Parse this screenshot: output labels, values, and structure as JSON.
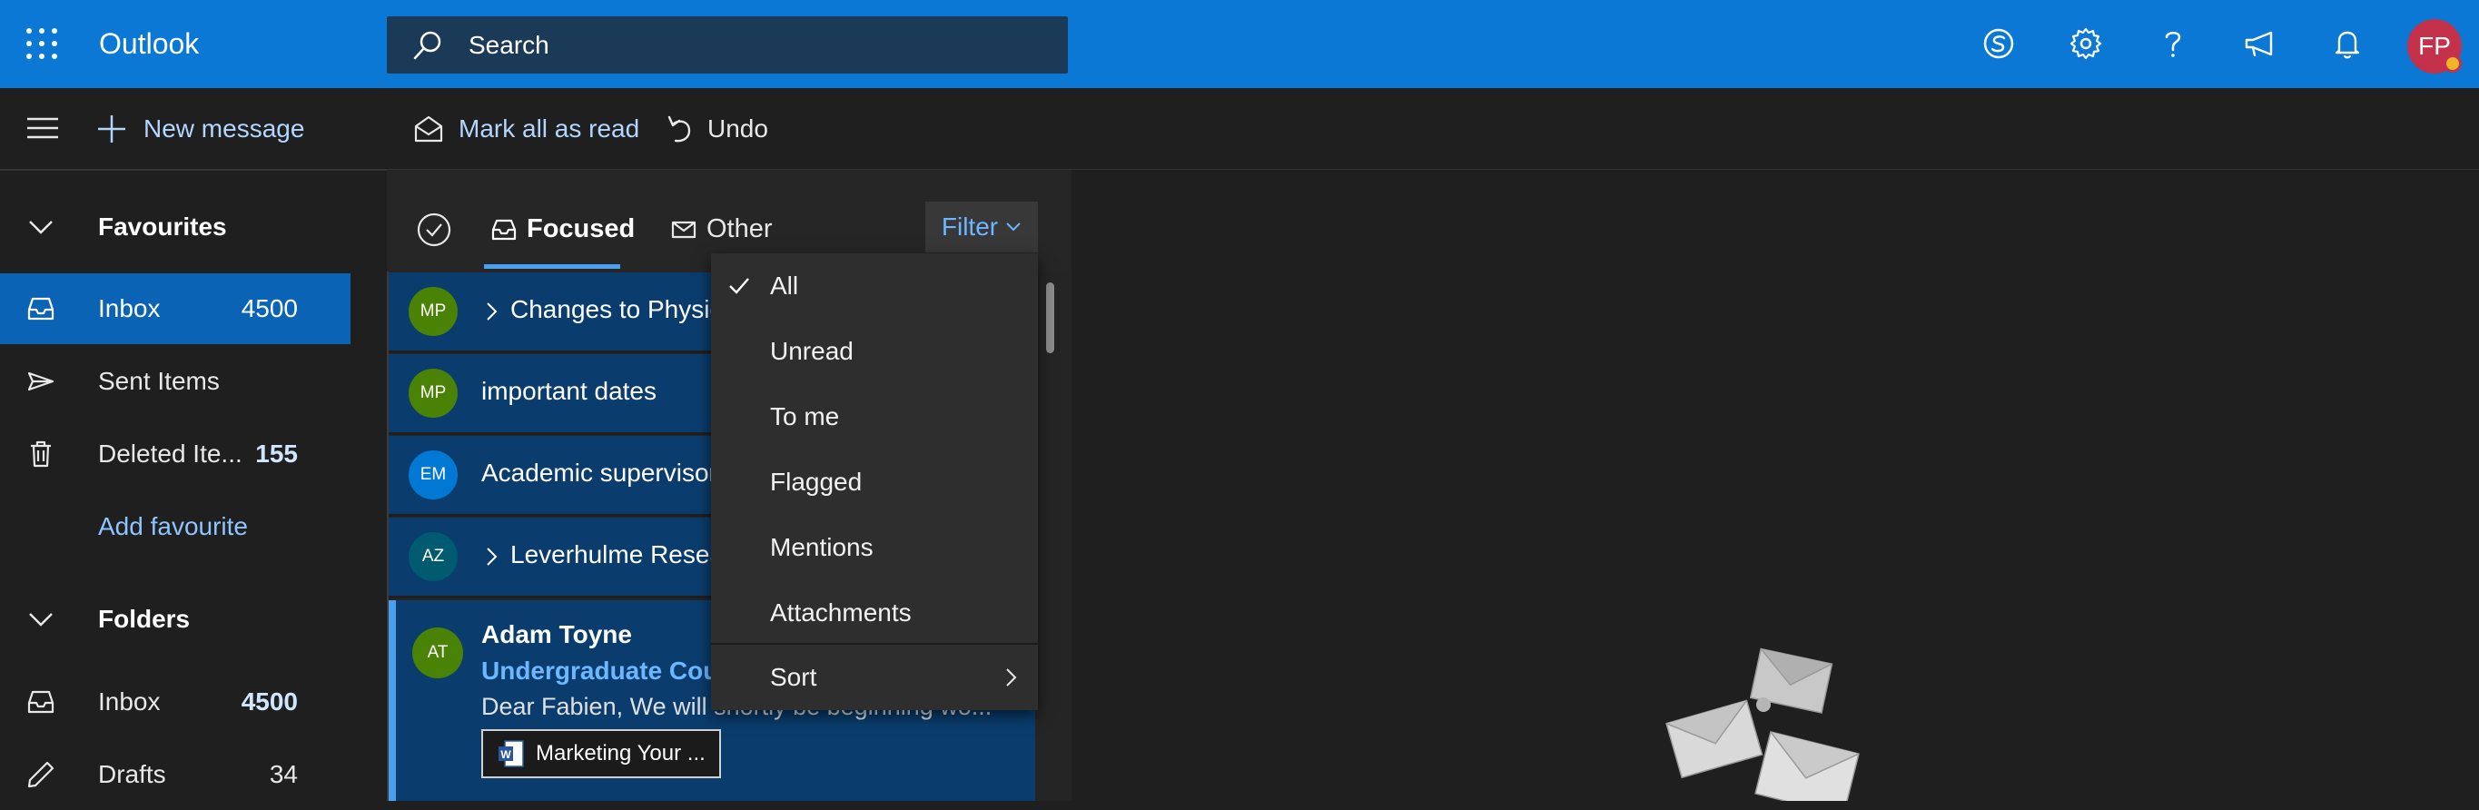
{
  "app": {
    "name": "Outlook"
  },
  "search": {
    "placeholder": "Search"
  },
  "user": {
    "initials": "FP"
  },
  "header_icons": [
    "skype-icon",
    "gear-icon",
    "help-icon",
    "feedback-icon",
    "bell-icon"
  ],
  "command_bar": {
    "new_message": "New message",
    "mark_all_read": "Mark all as read",
    "undo": "Undo"
  },
  "nav": {
    "favourites_header": "Favourites",
    "favourites": [
      {
        "label": "Inbox",
        "count": "4500"
      },
      {
        "label": "Sent Items",
        "count": ""
      },
      {
        "label": "Deleted Ite...",
        "count": "155"
      },
      {
        "label": "Add favourite",
        "count": ""
      }
    ],
    "folders_header": "Folders",
    "folders": [
      {
        "label": "Inbox",
        "count": "4500"
      },
      {
        "label": "Drafts",
        "count": "34"
      }
    ]
  },
  "list": {
    "tabs": {
      "focused": "Focused",
      "other": "Other"
    },
    "filter_label": "Filter",
    "messages": [
      {
        "initials": "MP",
        "subject": "Changes to Physic",
        "avatar_color": "#498205",
        "thread": true
      },
      {
        "initials": "MP",
        "subject": "important dates",
        "avatar_color": "#498205",
        "thread": false
      },
      {
        "initials": "EM",
        "subject": "Academic supervisor",
        "avatar_color": "#0078d4",
        "thread": false
      },
      {
        "initials": "AZ",
        "subject": "Leverhulme Resea",
        "avatar_color": "#005b70",
        "thread": true
      }
    ],
    "open_message": {
      "initials": "AT",
      "sender": "Adam Toyne",
      "subject": "Undergraduate Cour",
      "preview": "Dear Fabien, We will shortly be beginning wo...",
      "attachment": "Marketing Your ..."
    }
  },
  "filter_menu": {
    "items": [
      "All",
      "Unread",
      "To me",
      "Flagged",
      "Mentions",
      "Attachments"
    ],
    "selected": "All",
    "sort_label": "Sort"
  },
  "colors": {
    "header": "#0a78d4",
    "selected_nav": "#0a63b4",
    "list_row": "#0a3d6e",
    "accent": "#4aa0ef",
    "user_avatar": "#c4314b",
    "presence": "#f0b429"
  }
}
